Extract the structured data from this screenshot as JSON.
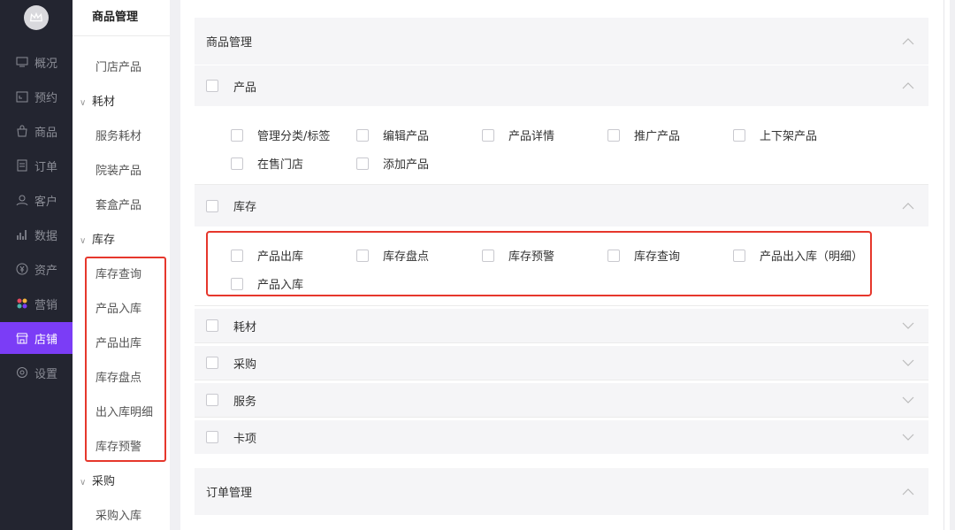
{
  "nav": {
    "items": [
      {
        "label": "概况",
        "icon": "monitor-icon"
      },
      {
        "label": "预约",
        "icon": "calendar-icon"
      },
      {
        "label": "商品",
        "icon": "bag-icon"
      },
      {
        "label": "订单",
        "icon": "order-icon"
      },
      {
        "label": "客户",
        "icon": "user-icon"
      },
      {
        "label": "数据",
        "icon": "chart-icon"
      },
      {
        "label": "资产",
        "icon": "yen-icon"
      },
      {
        "label": "营销",
        "icon": "grid-icon"
      },
      {
        "label": "店铺",
        "icon": "store-icon"
      },
      {
        "label": "设置",
        "icon": "gear-icon"
      }
    ],
    "active_color": "#7b3df6"
  },
  "submenu": {
    "title": "商品管理",
    "store_product": "门店产品",
    "groups": {
      "consumables": {
        "label": "耗材",
        "items": [
          "服务耗材",
          "院装产品",
          "套盒产品"
        ]
      },
      "inventory": {
        "label": "库存",
        "items": [
          "库存查询",
          "产品入库",
          "产品出库",
          "库存盘点",
          "出入库明细",
          "库存预警"
        ]
      },
      "purchase": {
        "label": "采购",
        "items": [
          "采购入库"
        ]
      }
    }
  },
  "permissions": {
    "section1_title": "商品管理",
    "product": {
      "label": "产品",
      "options": [
        "管理分类/标签",
        "编辑产品",
        "产品详情",
        "推广产品",
        "上下架产品",
        "在售门店",
        "添加产品"
      ]
    },
    "inventory": {
      "label": "库存",
      "options": [
        "产品出库",
        "库存盘点",
        "库存预警",
        "库存查询",
        "产品出入库（明细）",
        "产品入库"
      ]
    },
    "collapsed": [
      "耗材",
      "采购",
      "服务",
      "卡项"
    ],
    "section2_title": "订单管理"
  },
  "colors": {
    "highlight": "#e6372c"
  }
}
